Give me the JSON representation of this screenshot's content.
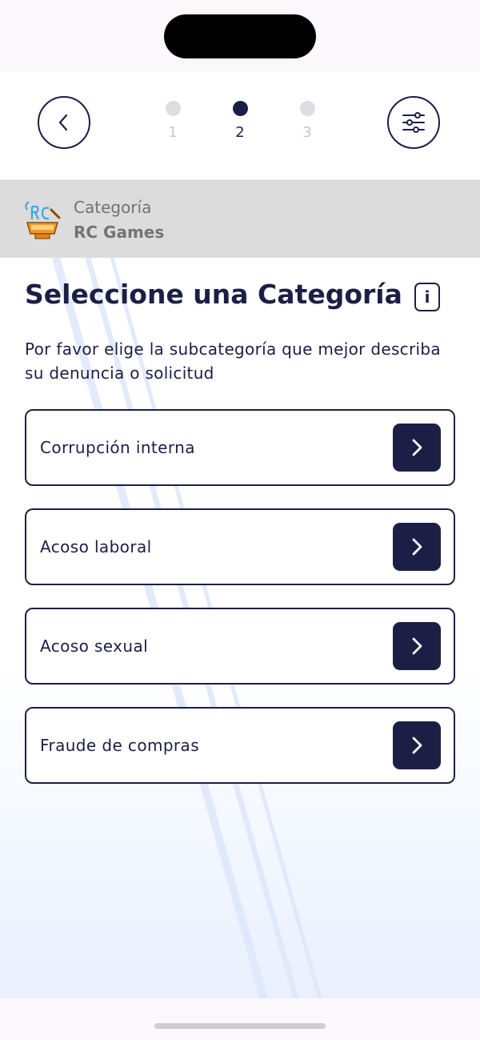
{
  "stepper": {
    "steps": [
      {
        "label": "1",
        "state": "inactive"
      },
      {
        "label": "2",
        "state": "active"
      },
      {
        "label": "3",
        "state": "inactive"
      }
    ]
  },
  "header": {
    "back_icon": "chevron-left-icon",
    "filter_icon": "sliders-icon"
  },
  "category": {
    "label": "Categoría",
    "value": "RC Games",
    "logo_icon": "rc-games-logo"
  },
  "main": {
    "title": "Seleccione una Categoría",
    "info_icon": "info-icon",
    "info_text": "i",
    "description": "Por favor elige la subcategoría que mejor describa su denuncia o solicitud",
    "options": [
      {
        "label": "Corrupción interna"
      },
      {
        "label": "Acoso laboral"
      },
      {
        "label": "Acoso sexual"
      },
      {
        "label": "Fraude de compras"
      }
    ]
  },
  "colors": {
    "primary": "#1c1f45",
    "category_bar": "#dcdcdc",
    "inactive_step": "#dcdde2",
    "logo_orange": "#f59a1e",
    "logo_blue": "#3fa7e0"
  }
}
